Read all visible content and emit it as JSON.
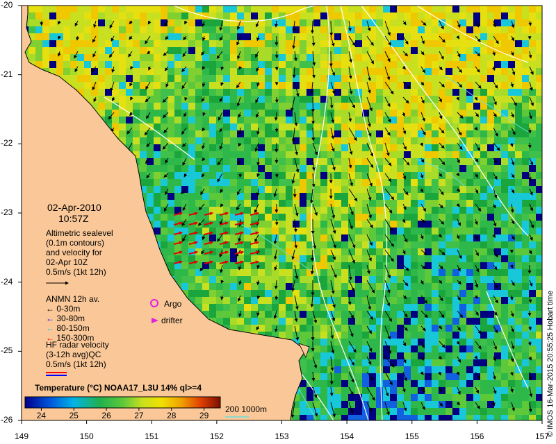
{
  "map": {
    "date": "02-Apr-2010",
    "time": "10:57Z",
    "credit": "© IMOS 16-Mar-2015 20:55:25 Hobart time",
    "x_ticks": [
      "149",
      "150",
      "151",
      "152",
      "153",
      "154",
      "155",
      "156",
      "157"
    ],
    "y_ticks": [
      "-20",
      "-21",
      "-22",
      "-23",
      "-24",
      "-25",
      "-26"
    ],
    "lon_range": [
      149,
      157
    ],
    "lat_range": [
      -26,
      -20
    ]
  },
  "legend": {
    "altimetry": {
      "line1": "Altimetric sealevel",
      "line2": "(0.1m contours)",
      "line3": "and velocity for",
      "line4": "02-Apr 10Z",
      "line5": "0.5m/s (1kt 12h)"
    },
    "anmn": {
      "title": "ANMN 12h av.",
      "items": [
        {
          "label": "0-30m",
          "color": "#000000"
        },
        {
          "label": "30-80m",
          "color": "#0000ff"
        },
        {
          "label": "80-150m",
          "color": "#00d0d0"
        },
        {
          "label": "150-300m",
          "color": "#ff0000"
        }
      ]
    },
    "argo": "Argo",
    "drifter": "drifter",
    "hf": {
      "line1": "HF radar velocity",
      "line2": "(3-12h avg)QC",
      "line3": "0.5m/s (1kt 12h)"
    }
  },
  "colorbar": {
    "title": "Temperature (°C) NOAA17_L3U 14% ql>=4",
    "ticks": [
      "24",
      "25",
      "26",
      "27",
      "28",
      "29"
    ],
    "range": [
      23.5,
      29.5
    ]
  },
  "bathymetry": {
    "label": "200  1000m",
    "color": "#66dddd"
  },
  "colors": {
    "land": "#fac898",
    "ocean_base": "#2fb84a",
    "contour": "#ffffff"
  }
}
